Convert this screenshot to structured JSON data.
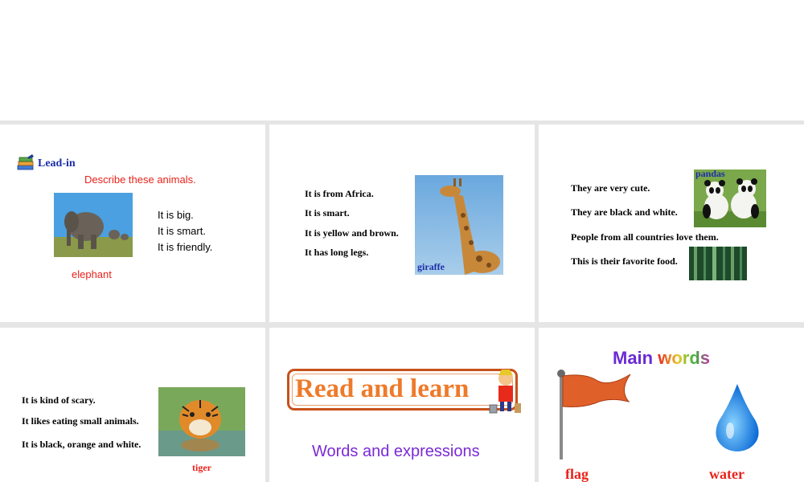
{
  "slides": [
    {
      "heading": "Lead-in",
      "instruction": "Describe these animals.",
      "sentences": [
        "It is big.",
        "It is smart.",
        "It is friendly."
      ],
      "caption": "elephant"
    },
    {
      "sentences": [
        "It is from Africa.",
        "It is smart.",
        "It is yellow and brown.",
        "It has long legs."
      ],
      "caption": "giraffe"
    },
    {
      "sentences": [
        "They are very cute.",
        "They are black and white.",
        "People from all countries love them.",
        "This is their favorite food."
      ],
      "caption": "pandas"
    },
    {
      "sentences": [
        "It is kind of scary.",
        "It likes eating small animals.",
        "It is black, orange and white."
      ],
      "caption": "tiger"
    },
    {
      "banner": "Read and learn",
      "subtitle": "Words and expressions"
    },
    {
      "title_part1": "Main",
      "title_part2": "words",
      "labels": [
        "flag",
        "water"
      ]
    }
  ],
  "colors": {
    "red": "#e8221a",
    "navy": "#1a2ea8",
    "orange": "#ee7a2a",
    "purple": "#7a2ad6",
    "flag": "#e0602a"
  },
  "icons": [
    "book-stack-icon",
    "flag-icon",
    "water-drop-icon",
    "painter-character-icon"
  ]
}
